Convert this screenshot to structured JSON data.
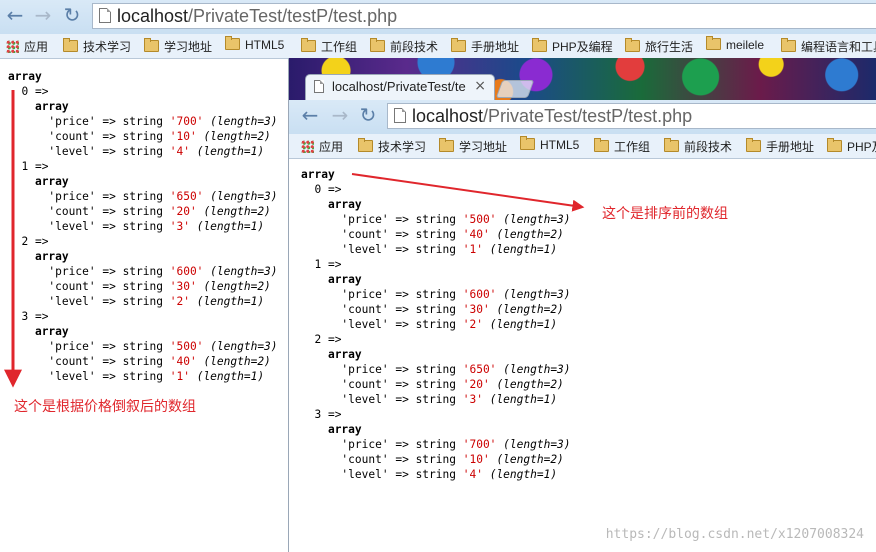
{
  "back_window": {
    "url_host": "localhost",
    "url_path": "/PrivateTest/testP/test.php",
    "bookmarks": [
      {
        "label": "应用",
        "icon": "apps-grid-icon"
      },
      {
        "label": "技术学习",
        "icon": "folder-icon"
      },
      {
        "label": "学习地址",
        "icon": "folder-icon"
      },
      {
        "label": "HTML5",
        "icon": "folder-icon"
      },
      {
        "label": "工作组",
        "icon": "folder-icon"
      },
      {
        "label": "前段技术",
        "icon": "folder-icon"
      },
      {
        "label": "手册地址",
        "icon": "folder-icon"
      },
      {
        "label": "PHP及编程",
        "icon": "folder-icon"
      },
      {
        "label": "旅行生活",
        "icon": "folder-icon"
      },
      {
        "label": "meilele",
        "icon": "folder-icon"
      },
      {
        "label": "编程语言和工具",
        "icon": "folder-icon"
      }
    ],
    "dump": {
      "root": "array",
      "items": [
        {
          "index": "0 =>",
          "type": "array",
          "fields": [
            {
              "key": "'price'",
              "arrow": "=>",
              "type": "string",
              "value": "'700'",
              "length": "(length=3)"
            },
            {
              "key": "'count'",
              "arrow": "=>",
              "type": "string",
              "value": "'10'",
              "length": "(length=2)"
            },
            {
              "key": "'level'",
              "arrow": "=>",
              "type": "string",
              "value": "'4'",
              "length": "(length=1)"
            }
          ]
        },
        {
          "index": "1 =>",
          "type": "array",
          "fields": [
            {
              "key": "'price'",
              "arrow": "=>",
              "type": "string",
              "value": "'650'",
              "length": "(length=3)"
            },
            {
              "key": "'count'",
              "arrow": "=>",
              "type": "string",
              "value": "'20'",
              "length": "(length=2)"
            },
            {
              "key": "'level'",
              "arrow": "=>",
              "type": "string",
              "value": "'3'",
              "length": "(length=1)"
            }
          ]
        },
        {
          "index": "2 =>",
          "type": "array",
          "fields": [
            {
              "key": "'price'",
              "arrow": "=>",
              "type": "string",
              "value": "'600'",
              "length": "(length=3)"
            },
            {
              "key": "'count'",
              "arrow": "=>",
              "type": "string",
              "value": "'30'",
              "length": "(length=2)"
            },
            {
              "key": "'level'",
              "arrow": "=>",
              "type": "string",
              "value": "'2'",
              "length": "(length=1)"
            }
          ]
        },
        {
          "index": "3 =>",
          "type": "array",
          "fields": [
            {
              "key": "'price'",
              "arrow": "=>",
              "type": "string",
              "value": "'500'",
              "length": "(length=3)"
            },
            {
              "key": "'count'",
              "arrow": "=>",
              "type": "string",
              "value": "'40'",
              "length": "(length=2)"
            },
            {
              "key": "'level'",
              "arrow": "=>",
              "type": "string",
              "value": "'1'",
              "length": "(length=1)"
            }
          ]
        }
      ]
    }
  },
  "front_window": {
    "tab_title": "localhost/PrivateTest/te",
    "tab_close": "×",
    "url_host": "localhost",
    "url_path": "/PrivateTest/testP/test.php",
    "bookmarks": [
      {
        "label": "应用",
        "icon": "apps-grid-icon"
      },
      {
        "label": "技术学习",
        "icon": "folder-icon"
      },
      {
        "label": "学习地址",
        "icon": "folder-icon"
      },
      {
        "label": "HTML5",
        "icon": "folder-icon"
      },
      {
        "label": "工作组",
        "icon": "folder-icon"
      },
      {
        "label": "前段技术",
        "icon": "folder-icon"
      },
      {
        "label": "手册地址",
        "icon": "folder-icon"
      },
      {
        "label": "PHP及",
        "icon": "folder-icon"
      }
    ],
    "dump": {
      "root": "array",
      "items": [
        {
          "index": "0 =>",
          "type": "array",
          "fields": [
            {
              "key": "'price'",
              "arrow": "=>",
              "type": "string",
              "value": "'500'",
              "length": "(length=3)"
            },
            {
              "key": "'count'",
              "arrow": "=>",
              "type": "string",
              "value": "'40'",
              "length": "(length=2)"
            },
            {
              "key": "'level'",
              "arrow": "=>",
              "type": "string",
              "value": "'1'",
              "length": "(length=1)"
            }
          ]
        },
        {
          "index": "1 =>",
          "type": "array",
          "fields": [
            {
              "key": "'price'",
              "arrow": "=>",
              "type": "string",
              "value": "'600'",
              "length": "(length=3)"
            },
            {
              "key": "'count'",
              "arrow": "=>",
              "type": "string",
              "value": "'30'",
              "length": "(length=2)"
            },
            {
              "key": "'level'",
              "arrow": "=>",
              "type": "string",
              "value": "'2'",
              "length": "(length=1)"
            }
          ]
        },
        {
          "index": "2 =>",
          "type": "array",
          "fields": [
            {
              "key": "'price'",
              "arrow": "=>",
              "type": "string",
              "value": "'650'",
              "length": "(length=3)"
            },
            {
              "key": "'count'",
              "arrow": "=>",
              "type": "string",
              "value": "'20'",
              "length": "(length=2)"
            },
            {
              "key": "'level'",
              "arrow": "=>",
              "type": "string",
              "value": "'3'",
              "length": "(length=1)"
            }
          ]
        },
        {
          "index": "3 =>",
          "type": "array",
          "fields": [
            {
              "key": "'price'",
              "arrow": "=>",
              "type": "string",
              "value": "'700'",
              "length": "(length=3)"
            },
            {
              "key": "'count'",
              "arrow": "=>",
              "type": "string",
              "value": "'10'",
              "length": "(length=2)"
            },
            {
              "key": "'level'",
              "arrow": "=>",
              "type": "string",
              "value": "'4'",
              "length": "(length=1)"
            }
          ]
        }
      ]
    }
  },
  "annotations": {
    "sorted_desc_note": "这个是根据价格倒叙后的数组",
    "before_sort_note": "这个是排序前的数组",
    "accent_color": "#e0262c"
  },
  "watermark": "https://blog.csdn.net/x1207008324"
}
